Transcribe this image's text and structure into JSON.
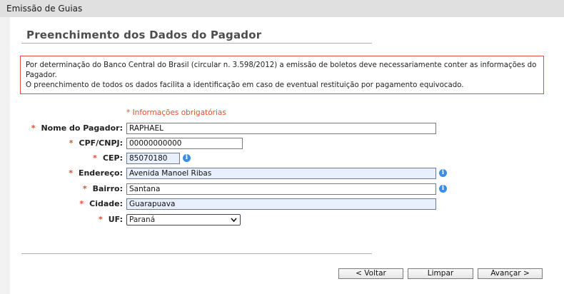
{
  "window": {
    "title": "Emissão de Guias"
  },
  "section": {
    "title": "Preenchimento dos Dados do Pagador"
  },
  "notice": {
    "line1": "Por determinação do Banco Central do Brasil (circular n. 3.598/2012) a emissão de boletos deve necessariamente conter as informações do Pagador.",
    "line2": "O preenchimento de todos os dados facilita a identificação em caso de eventual restituição por pagamento equivocado."
  },
  "form": {
    "required_note": "* Informações obrigatórias",
    "asterisk": "*",
    "nome": {
      "label": "Nome do Pagador:",
      "value": "RAPHAEL"
    },
    "cpf": {
      "label": "CPF/CNPJ:",
      "value": "00000000000"
    },
    "cep": {
      "label": "CEP:",
      "value": "85070180"
    },
    "endereco": {
      "label": "Endereço:",
      "value": "Avenida Manoel Ribas"
    },
    "bairro": {
      "label": "Bairro:",
      "value": "Santana"
    },
    "cidade": {
      "label": "Cidade:",
      "value": "Guarapuava"
    },
    "uf": {
      "label": "UF:",
      "value": "Paraná"
    },
    "info_glyph": "i"
  },
  "buttons": {
    "back": "< Voltar",
    "clear": "Limpar",
    "next": "Avançar >"
  },
  "colors": {
    "accent_required": "#e2502a",
    "notice_border": "#e24d4d",
    "info_icon": "#3a8ee6",
    "autofill_bg": "#e8f0fe"
  }
}
